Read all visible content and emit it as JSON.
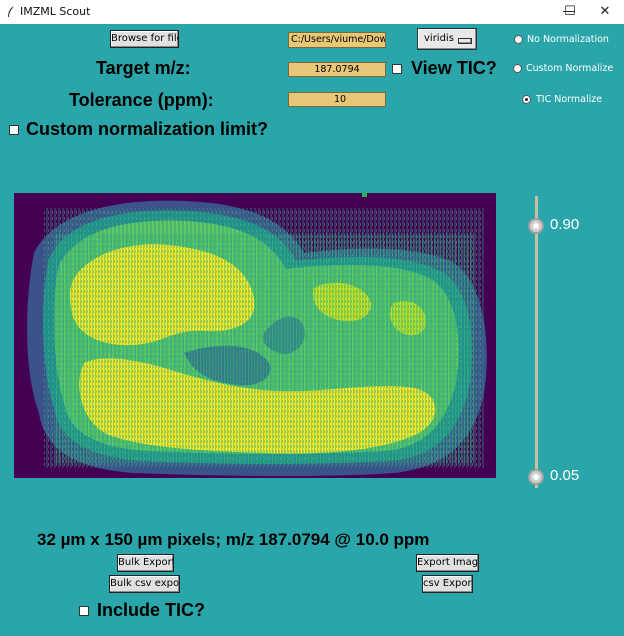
{
  "window": {
    "title": "IMZML Scout",
    "minimize_glyph": "—",
    "maximize_glyph": "☐",
    "close_glyph": "✕"
  },
  "controls": {
    "browse_label": "Browse for file",
    "file_path_value": "C:/Users/viume/Downl",
    "colormap_value": "viridis",
    "target_label": "Target m/z:",
    "target_value": "187.0794",
    "tolerance_label": "Tolerance (ppm):",
    "tolerance_value": "10",
    "view_tic_label": "View TIC?",
    "custom_norm_limit_label": "Custom normalization limit?"
  },
  "normalization": {
    "options": [
      "No Normalization",
      "Custom Normalize",
      "TIC Normalize"
    ],
    "selected": "TIC Normalize"
  },
  "slider": {
    "upper_value": "0.90",
    "lower_value": "0.05"
  },
  "image_info": "32 µm x 150 µm pixels; m/z 187.0794 @ 10.0 ppm",
  "export": {
    "bulk_export_label": "Bulk Export",
    "bulk_csv_export_label": "Bulk csv export",
    "export_image_label": "Export Image",
    "csv_export_label": "csv Export",
    "include_tic_label": "Include TIC?"
  },
  "colors": {
    "background": "#2aa6ab",
    "entry_fill": "#e8c876",
    "viridis_low": "#440154",
    "viridis_high": "#fde725"
  }
}
